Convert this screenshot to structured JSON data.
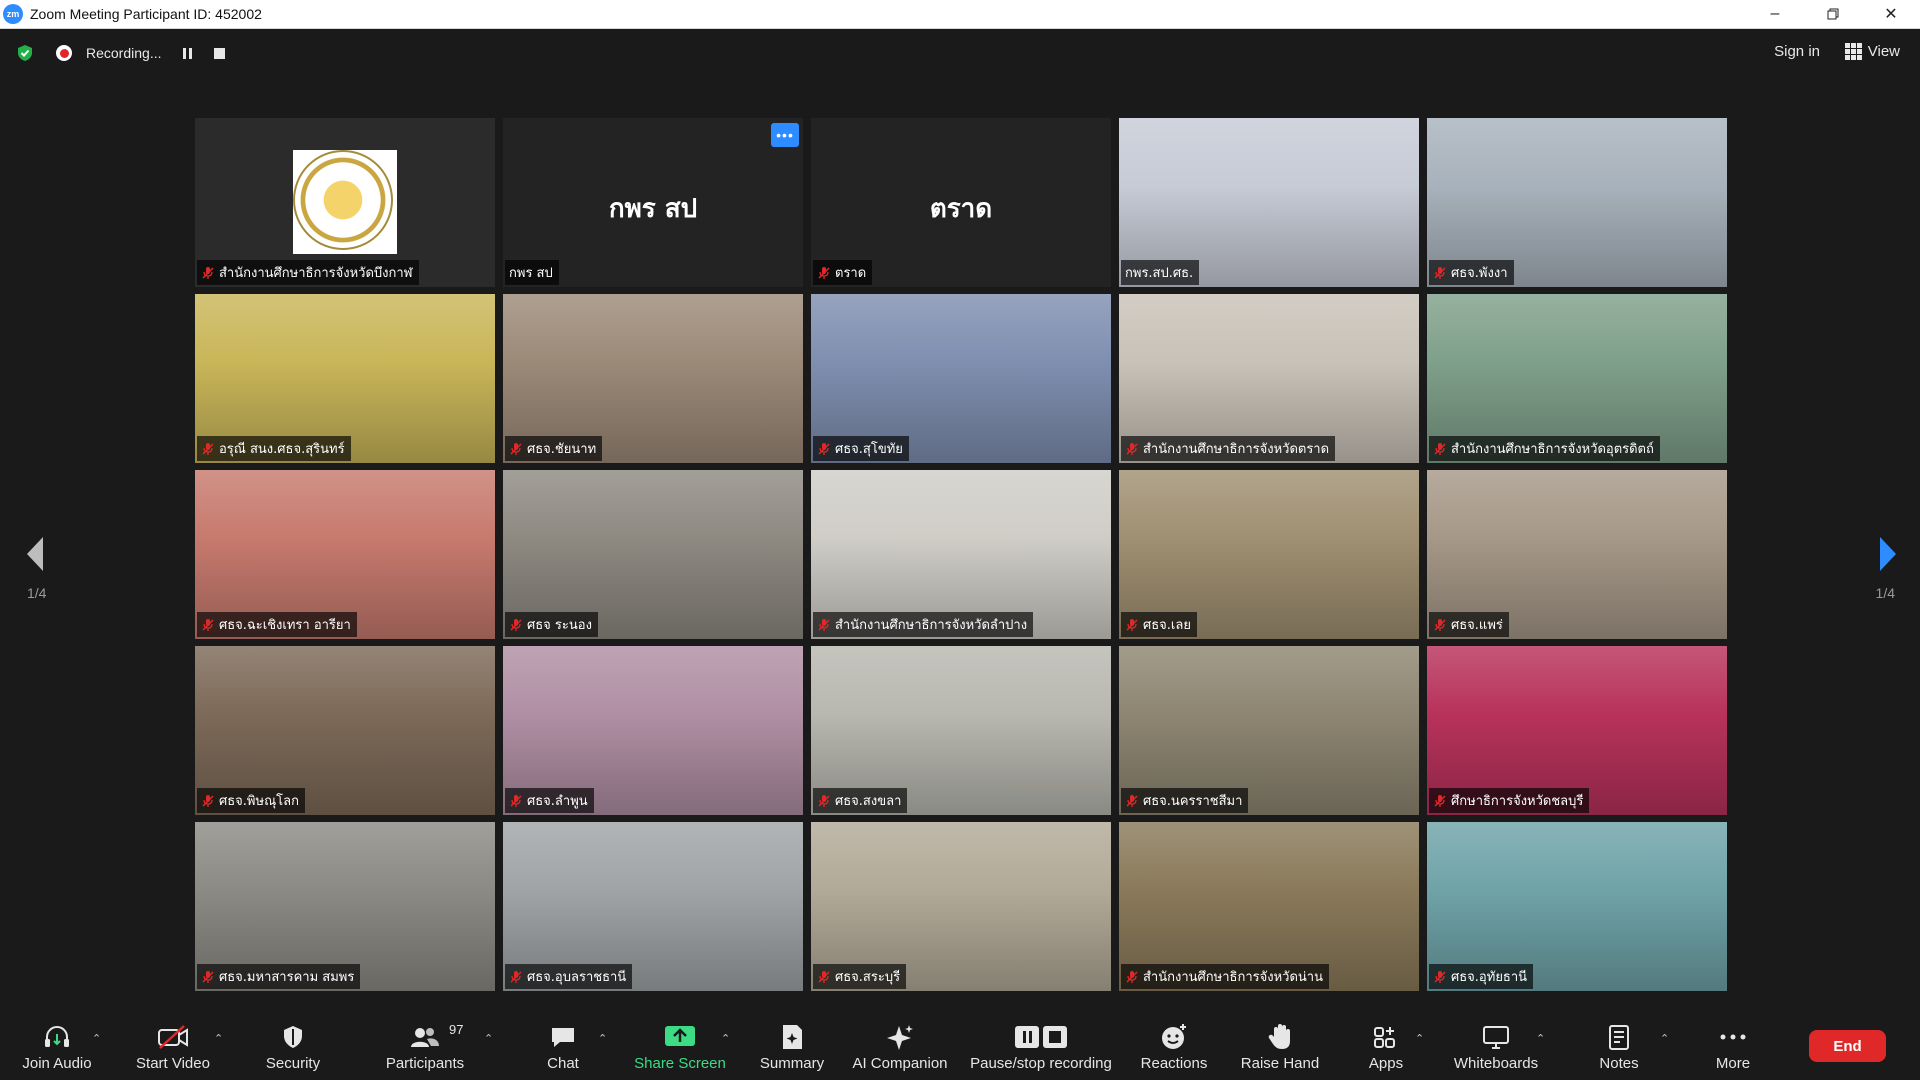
{
  "window": {
    "app_icon": "zm",
    "title": "Zoom Meeting Participant ID: 452002",
    "controls": [
      "minimize-icon",
      "restore-icon",
      "close-icon"
    ]
  },
  "topbar": {
    "recording_label": "Recording...",
    "sign_in": "Sign in",
    "view": "View"
  },
  "gallery": {
    "page_left": "1/4",
    "page_right": "1/4",
    "tiles": [
      {
        "name": "สำนักงานศึกษาธิการจังหวัดบึงกาฬ",
        "muted": true,
        "kind": "emblem",
        "bg": "#2b2b2b"
      },
      {
        "name": "กพร สป",
        "muted": false,
        "kind": "text",
        "cover": "กพร สป",
        "bg": "#232323",
        "menu": true
      },
      {
        "name": "ตราด",
        "muted": true,
        "kind": "text",
        "cover": "ตราด",
        "bg": "#232323"
      },
      {
        "name": "กพร.สป.ศธ.",
        "muted": false,
        "kind": "video",
        "active": true,
        "bg": "#c7cbd6"
      },
      {
        "name": "ศธจ.พังงา",
        "muted": true,
        "kind": "video",
        "bg": "#a8b2bc"
      },
      {
        "name": "อรุณี สนง.ศธจ.สุรินทร์",
        "muted": true,
        "kind": "video",
        "bg": "#c9b659"
      },
      {
        "name": "ศธจ.ชัยนาท",
        "muted": true,
        "kind": "video",
        "bg": "#9c8a78"
      },
      {
        "name": "ศธจ.สุโขทัย",
        "muted": true,
        "kind": "video",
        "bg": "#7f8fb0"
      },
      {
        "name": "สำนักงานศึกษาธิการจังหวัดตราด",
        "muted": true,
        "kind": "video",
        "bg": "#c9c2b8"
      },
      {
        "name": "สำนักงานศึกษาธิการจังหวัดอุตรดิตถ์",
        "muted": true,
        "kind": "video",
        "bg": "#7fa08a"
      },
      {
        "name": "ศธจ.ฉะเชิงเทรา อารียา",
        "muted": true,
        "kind": "video",
        "bg": "#c77a6e"
      },
      {
        "name": "ศธจ ระนอง",
        "muted": true,
        "kind": "video",
        "bg": "#8e8a82"
      },
      {
        "name": "สำนักงานศึกษาธิการจังหวัดลำปาง",
        "muted": true,
        "kind": "video",
        "bg": "#cfcdc6"
      },
      {
        "name": "ศธจ.เลย",
        "muted": true,
        "kind": "video",
        "bg": "#a09072"
      },
      {
        "name": "ศธจ.แพร่",
        "muted": true,
        "kind": "video",
        "bg": "#a69888"
      },
      {
        "name": "ศธจ.พิษณุโลก",
        "muted": true,
        "kind": "video",
        "bg": "#7d6a58"
      },
      {
        "name": "ศธจ.ลำพูน",
        "muted": true,
        "kind": "video",
        "bg": "#b08fa4"
      },
      {
        "name": "ศธจ.สงขลา",
        "muted": true,
        "kind": "video",
        "bg": "#b8b8b0"
      },
      {
        "name": "ศธจ.นครราชสีมา",
        "muted": true,
        "kind": "video",
        "bg": "#8e8672"
      },
      {
        "name": "ศึกษาธิการจังหวัดชลบุรี",
        "muted": true,
        "kind": "video",
        "bg": "#b8325c"
      },
      {
        "name": "ศธจ.มหาสารคาม สมพร",
        "muted": true,
        "kind": "video",
        "bg": "#8c8a84"
      },
      {
        "name": "ศธจ.อุบลราชธานี",
        "muted": true,
        "kind": "video",
        "bg": "#a0a4a6"
      },
      {
        "name": "ศธจ.สระบุรี",
        "muted": true,
        "kind": "video",
        "bg": "#b2aa98"
      },
      {
        "name": "สำนักงานศึกษาธิการจังหวัดน่าน",
        "muted": true,
        "kind": "video",
        "bg": "#8a7a5a"
      },
      {
        "name": "ศธจ.อุทัยธานี",
        "muted": true,
        "kind": "video",
        "bg": "#6fa3a8"
      }
    ]
  },
  "toolbar": {
    "join_audio": "Join Audio",
    "start_video": "Start Video",
    "security": "Security",
    "participants": "Participants",
    "participants_count": "97",
    "chat": "Chat",
    "share_screen": "Share Screen",
    "summary": "Summary",
    "ai_companion": "AI Companion",
    "pause_stop": "Pause/stop recording",
    "reactions": "Reactions",
    "raise_hand": "Raise Hand",
    "apps": "Apps",
    "whiteboards": "Whiteboards",
    "notes": "Notes",
    "more": "More",
    "end": "End"
  },
  "colors": {
    "accent_blue": "#2d8cff",
    "active_border": "#d6e84e",
    "share_green": "#3ddc84",
    "end_red": "#e02828"
  }
}
